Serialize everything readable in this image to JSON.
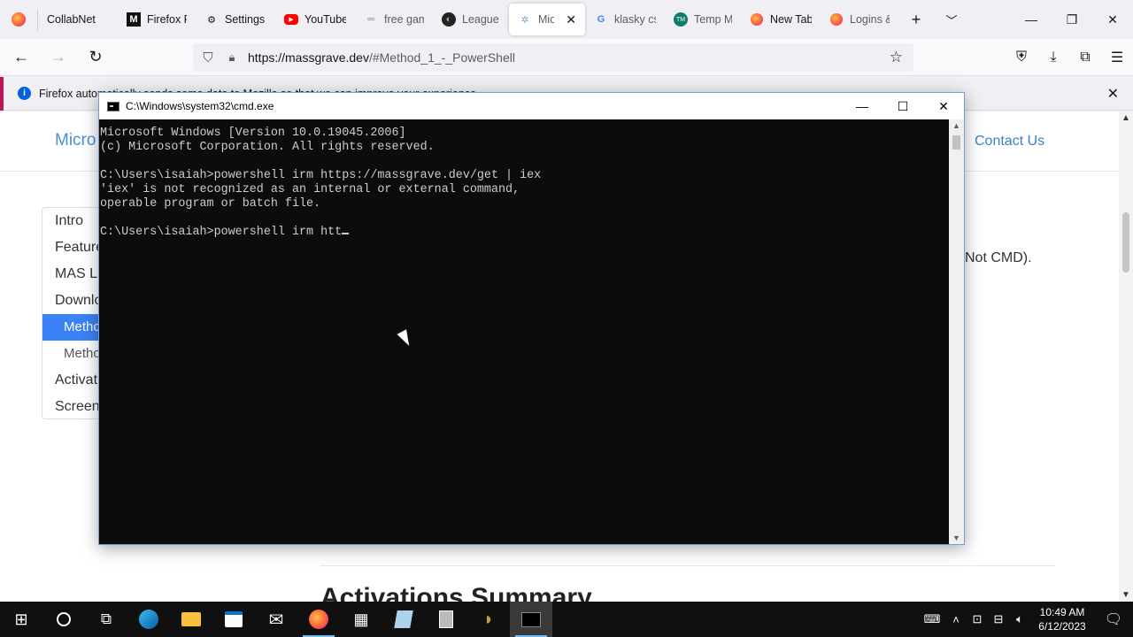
{
  "browser": {
    "tabs": [
      {
        "label": "CollabNet",
        "icon": "collabnet-icon"
      },
      {
        "label": "Firefox P",
        "icon": "medium-icon"
      },
      {
        "label": "Settings",
        "icon": "gear-icon"
      },
      {
        "label": "YouTube",
        "icon": "youtube-icon"
      },
      {
        "label": "free gam",
        "icon": "gamepad-icon"
      },
      {
        "label": "League c",
        "icon": "league-icon"
      },
      {
        "label": "Micro",
        "icon": "loading-icon"
      },
      {
        "label": "klasky cs",
        "icon": "google-icon"
      },
      {
        "label": "Temp M",
        "icon": "temp-mail-icon"
      },
      {
        "label": "New Tab",
        "icon": "firefox-icon"
      },
      {
        "label": "Logins &",
        "icon": "firefox-icon"
      }
    ],
    "url_host": "https://massgrave.dev",
    "url_path": "/#Method_1_-_PowerShell",
    "notification": "Firefox automatically sends some data to Mozilla so that we can improve your experience."
  },
  "page": {
    "brand": "Micro",
    "contact": "Contact Us",
    "toc": [
      "Intro",
      "Feature",
      "MAS L",
      "Downlo",
      "Metho",
      "Metho",
      "Activat",
      "Screen"
    ],
    "side_text": "Not CMD).",
    "heading": "Activations Summary"
  },
  "cmd": {
    "title": "C:\\Windows\\system32\\cmd.exe",
    "lines": [
      "Microsoft Windows [Version 10.0.19045.2006]",
      "(c) Microsoft Corporation. All rights reserved.",
      "",
      "C:\\Users\\isaiah>powershell irm https://massgrave.dev/get | iex",
      "'iex' is not recognized as an internal or external command,",
      "operable program or batch file.",
      ""
    ],
    "prompt_line": "C:\\Users\\isaiah>powershell irm htt"
  },
  "taskbar": {
    "time": "10:49 AM",
    "date": "6/12/2023"
  }
}
